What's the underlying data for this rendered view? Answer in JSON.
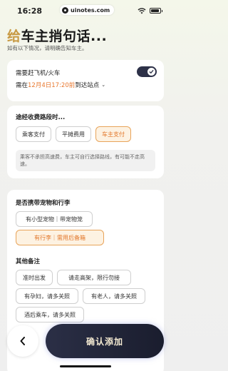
{
  "status": {
    "time": "16:28",
    "url": "uinotes.com"
  },
  "header": {
    "title_accent": "给",
    "title_rest": "车主捎句话...",
    "subtitle": "如有以下情况，请明确告知车主。"
  },
  "flight": {
    "label": "需要赶飞机/火车",
    "toggle_on": true,
    "arrive_prefix": "需在",
    "arrive_time": "12月4日17:20前",
    "arrive_suffix": "到达站点"
  },
  "toll": {
    "title": "途经收费路段时...",
    "options": [
      "乘客支付",
      "平摊费用",
      "车主支付"
    ],
    "selected": "车主支付",
    "note": "乘客不承担高速费，车主可自行选择路线，有可能不走高速。"
  },
  "pets": {
    "title": "是否携带宠物和行李",
    "options": [
      "有小型宠物｜带宠物笼",
      "有行李｜需用后备箱"
    ],
    "selected": "有行李｜需用后备箱"
  },
  "remarks": {
    "title": "其他备注",
    "options": [
      "准时出发",
      "请走高架，限行勿接",
      "有孕妇，请多关照",
      "有老人，请多关照",
      "酒后乘车，请多关照"
    ]
  },
  "footer": {
    "back_icon": "back-arrow-icon",
    "confirm_label": "确认添加"
  },
  "colors": {
    "accent": "#e8772e",
    "dark": "#2b2f46"
  }
}
